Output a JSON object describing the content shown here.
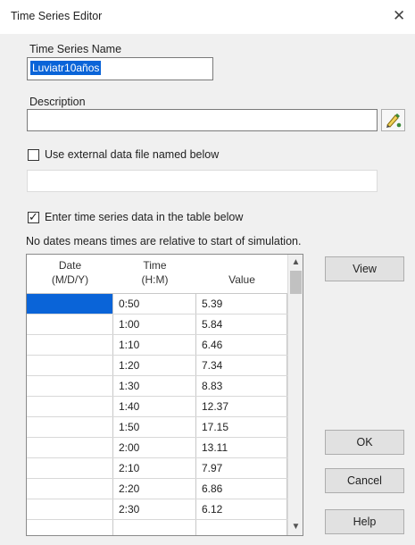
{
  "window": {
    "title": "Time Series Editor",
    "close_glyph": "✕"
  },
  "name_field": {
    "label": "Time Series Name",
    "value": "Luviatr10años"
  },
  "description_field": {
    "label": "Description",
    "value": ""
  },
  "edit_button": {
    "icon": "pencil-icon"
  },
  "external_file": {
    "label": "Use external data file named below",
    "checked": false,
    "path": ""
  },
  "table_entry": {
    "label": "Enter time series data in the table below",
    "checked": true
  },
  "note": "No dates means times are relative to start of simulation.",
  "table": {
    "headers": {
      "date_line1": "Date",
      "date_line2": "(M/D/Y)",
      "time_line1": "Time",
      "time_line2": "(H:M)",
      "value": "Value"
    },
    "rows": [
      {
        "date": "",
        "time": "0:50",
        "value": "5.39"
      },
      {
        "date": "",
        "time": "1:00",
        "value": "5.84"
      },
      {
        "date": "",
        "time": "1:10",
        "value": "6.46"
      },
      {
        "date": "",
        "time": "1:20",
        "value": "7.34"
      },
      {
        "date": "",
        "time": "1:30",
        "value": "8.83"
      },
      {
        "date": "",
        "time": "1:40",
        "value": "12.37"
      },
      {
        "date": "",
        "time": "1:50",
        "value": "17.15"
      },
      {
        "date": "",
        "time": "2:00",
        "value": "13.11"
      },
      {
        "date": "",
        "time": "2:10",
        "value": "7.97"
      },
      {
        "date": "",
        "time": "2:20",
        "value": "6.86"
      },
      {
        "date": "",
        "time": "2:30",
        "value": "6.12"
      }
    ]
  },
  "buttons": {
    "view": "View",
    "ok": "OK",
    "cancel": "Cancel",
    "help": "Help"
  },
  "colors": {
    "selection": "#0a64d8",
    "background": "#f0f0f0"
  }
}
